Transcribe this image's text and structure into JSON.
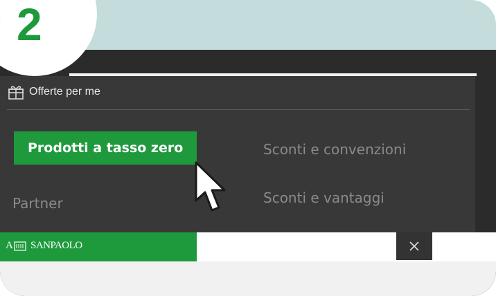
{
  "step": {
    "number": "2"
  },
  "menu": {
    "header_label": "Offerte per me",
    "items": [
      {
        "label": "Prodotti a tasso zero",
        "active": true
      },
      {
        "label": "Sconti e convenzioni",
        "active": false
      },
      {
        "label": "Partner",
        "active": false
      },
      {
        "label": "Sconti e vantaggi",
        "active": false
      }
    ]
  },
  "footer": {
    "brand_text": "SANPAOLO",
    "brand_prefix": "A"
  },
  "icons": {
    "header": "gift-icon",
    "close": "close-icon",
    "cursor": "mouse-pointer-icon"
  },
  "colors": {
    "brand_green": "#1e9a3c",
    "panel_bg": "#383838",
    "frame_bg": "#2b2b2b",
    "accent_band": "#c4dcdc"
  }
}
